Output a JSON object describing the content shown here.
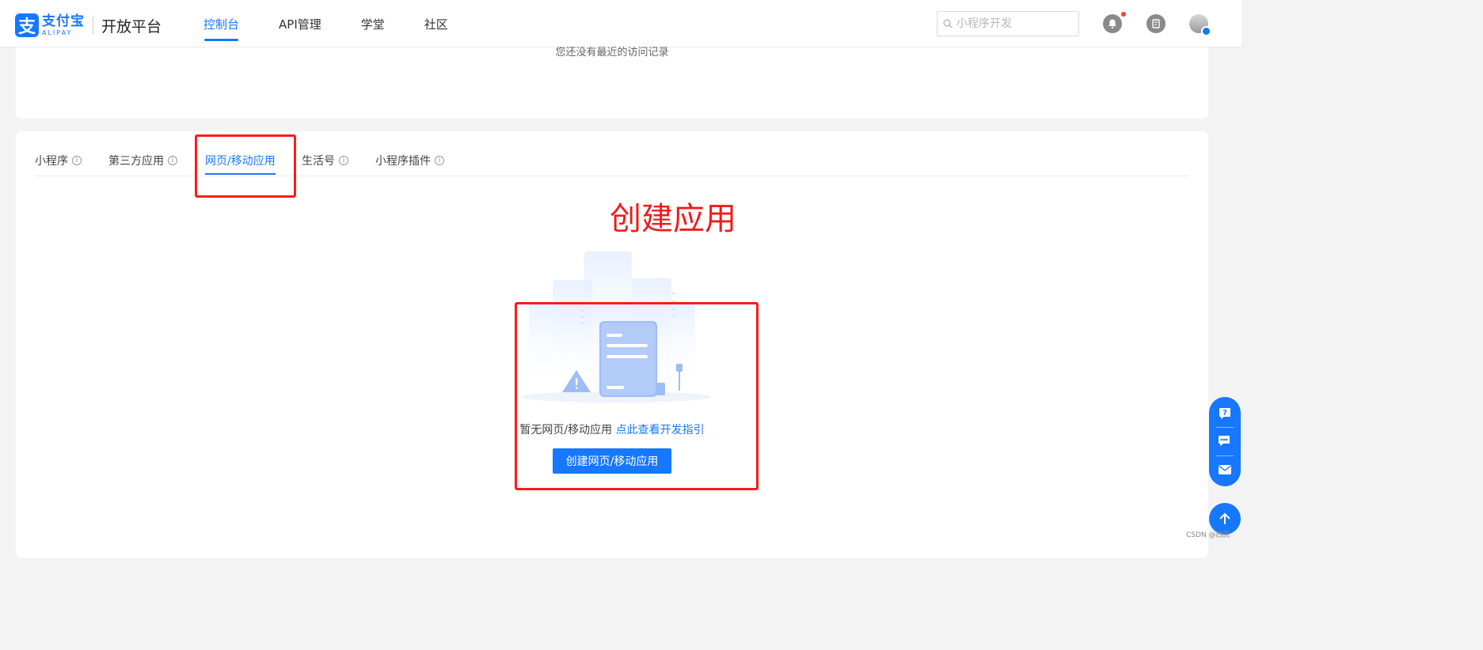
{
  "header": {
    "logo_mark": "支",
    "logo_cn": "支付宝",
    "logo_en": "ALIPAY",
    "platform": "开放平台",
    "nav": [
      {
        "label": "控制台",
        "active": true
      },
      {
        "label": "API管理",
        "active": false
      },
      {
        "label": "学堂",
        "active": false
      },
      {
        "label": "社区",
        "active": false
      }
    ],
    "search_placeholder": "小程序开发",
    "icons": [
      "bell-icon",
      "document-icon",
      "avatar"
    ]
  },
  "recent": {
    "empty_text": "您还没有最近的访问记录"
  },
  "tabs": [
    {
      "label": "小程序",
      "info": true,
      "active": false
    },
    {
      "label": "第三方应用",
      "info": true,
      "active": false
    },
    {
      "label": "网页/移动应用",
      "info": false,
      "active": true
    },
    {
      "label": "生活号",
      "info": true,
      "active": false
    },
    {
      "label": "小程序插件",
      "info": true,
      "active": false
    }
  ],
  "annotation": "创建应用",
  "empty": {
    "text": "暂无网页/移动应用",
    "link": "点此查看开发指引",
    "button": "创建网页/移动应用"
  },
  "float_bar": [
    "help-icon",
    "chat-icon",
    "mail-icon"
  ],
  "back_to_top": "arrow-up-icon",
  "watermark": "CSDN @西民",
  "colors": {
    "primary": "#1677ff",
    "annotation": "#ee1c1c",
    "background": "#f3f3f3"
  }
}
